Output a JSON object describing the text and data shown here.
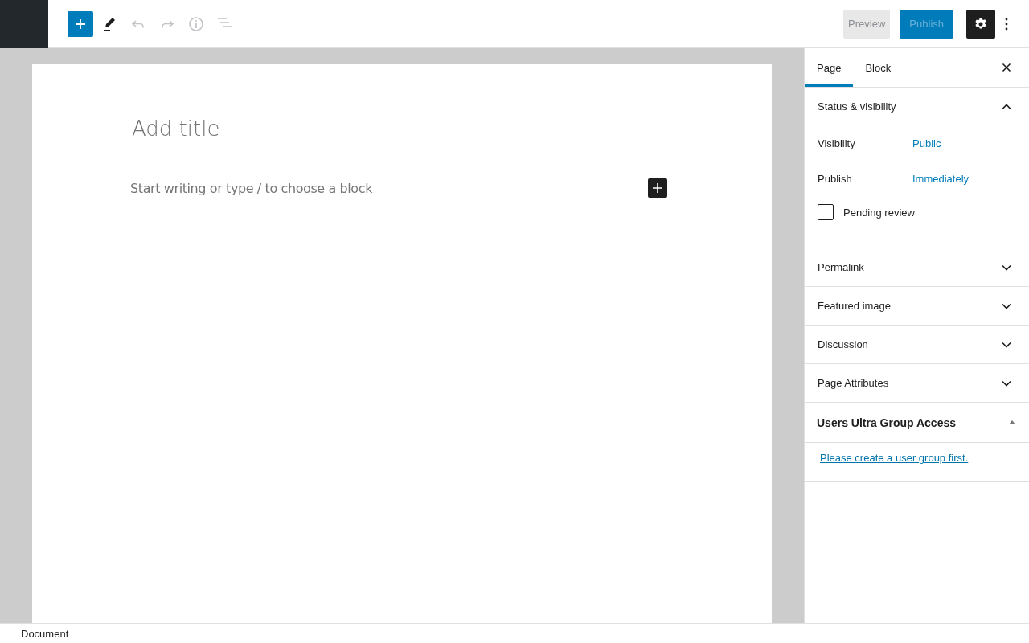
{
  "toolbar": {
    "tools": [
      {
        "kind": "add",
        "disabled": false
      },
      {
        "kind": "edit",
        "disabled": false
      },
      {
        "kind": "undo",
        "disabled": true
      },
      {
        "kind": "redo",
        "disabled": true
      },
      {
        "kind": "info",
        "disabled": true
      },
      {
        "kind": "outline",
        "disabled": true
      }
    ],
    "preview": {
      "label": "Preview",
      "disabled": true
    },
    "publish": {
      "label": "Publish",
      "disabled": true
    },
    "settings": {
      "on": true
    }
  },
  "editor": {
    "title_placeholder": "Add title",
    "body_placeholder": "Start writing or type / to choose a block"
  },
  "sidebar": {
    "tabs": [
      {
        "label": "Page",
        "selected": true
      },
      {
        "label": "Block",
        "selected": false
      }
    ],
    "panels": [
      {
        "title": "Status & visibility",
        "expanded": true,
        "rows": [
          {
            "label": "Visibility",
            "value": "Public"
          },
          {
            "label": "Publish",
            "value": "Immediately"
          }
        ],
        "checkbox": {
          "label": "Pending review",
          "checked": false
        }
      },
      {
        "title": "Permalink",
        "expanded": false
      },
      {
        "title": "Featured image",
        "expanded": false
      },
      {
        "title": "Discussion",
        "expanded": false
      },
      {
        "title": "Page Attributes",
        "expanded": false
      }
    ],
    "metabox": {
      "title": "Users Ultra Group Access",
      "expanded": true,
      "link": "Please create a user group first."
    }
  },
  "status_bar": {
    "breadcrumb": "Document"
  }
}
